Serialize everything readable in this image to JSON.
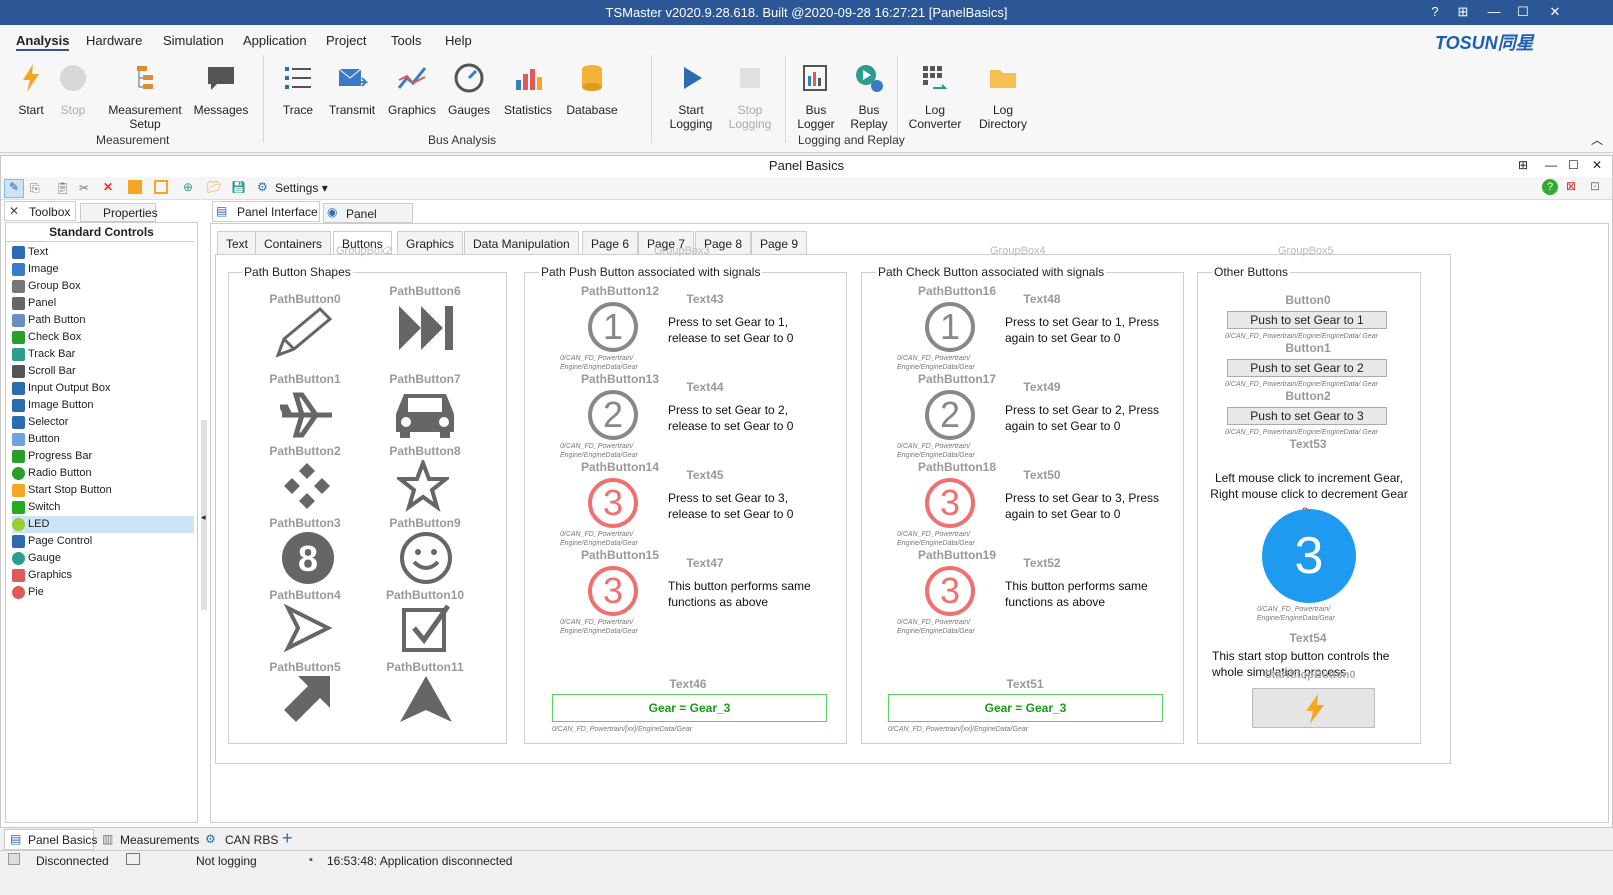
{
  "title": "TSMaster v2020.9.28.618. Built @2020-09-28 16:27:21 [PanelBasics]",
  "brand": "TOSUN同星",
  "window_buttons": [
    "?",
    "⊞",
    "—",
    "☐",
    "✕"
  ],
  "menu": [
    "Analysis",
    "Hardware",
    "Simulation",
    "Application",
    "Project",
    "Tools",
    "Help"
  ],
  "ribbon": {
    "start": "Start",
    "stop": "Stop",
    "measurement_setup_1": "Measurement",
    "measurement_setup_2": "Setup",
    "messages": "Messages",
    "trace": "Trace",
    "transmit": "Transmit",
    "graphics": "Graphics",
    "gauges": "Gauges",
    "statistics": "Statistics",
    "database": "Database",
    "start_logging_1": "Start",
    "start_logging_2": "Logging",
    "stop_logging_1": "Stop",
    "stop_logging_2": "Logging",
    "bus_logger_1": "Bus",
    "bus_logger_2": "Logger",
    "bus_replay_1": "Bus",
    "bus_replay_2": "Replay",
    "log_converter_1": "Log",
    "log_converter_2": "Converter",
    "log_directory_1": "Log",
    "log_directory_2": "Directory",
    "group_measurement": "Measurement",
    "group_bus_analysis": "Bus Analysis",
    "group_logging": "Logging and Replay"
  },
  "panel": {
    "title": "Panel Basics",
    "settings": "Settings",
    "toolbox_tab": "Toolbox",
    "properties_tab": "Properties",
    "interface_tab": "Panel Interface",
    "source_tab": "Panel Source",
    "standard_controls": "Standard Controls",
    "controls": [
      "Text",
      "Image",
      "Group Box",
      "Panel",
      "Path Button",
      "Check Box",
      "Track Bar",
      "Scroll Bar",
      "Input Output Box",
      "Image Button",
      "Selector",
      "Button",
      "Progress Bar",
      "Radio Button",
      "Start Stop Button",
      "Switch",
      "LED",
      "Page Control",
      "Gauge",
      "Graphics",
      "Pie"
    ],
    "page_tabs": [
      "Text",
      "Containers",
      "Buttons",
      "Graphics",
      "Data Manipulation",
      "Page 6",
      "Page 7",
      "Page 8",
      "Page 9"
    ]
  },
  "groups": {
    "g1": "Path Button Shapes",
    "g2": "Path Push Button associated with signals",
    "g3": "Path Check Button associated with signals",
    "g4": "Other Buttons",
    "ghost1": "GroupBox2",
    "ghost2": "GroupBox3",
    "ghost3": "GroupBox4",
    "ghost4": "GroupBox5"
  },
  "path_buttons": [
    "PathButton0",
    "PathButton6",
    "PathButton1",
    "PathButton7",
    "PathButton2",
    "PathButton8",
    "PathButton3",
    "PathButton9",
    "PathButton4",
    "PathButton10",
    "PathButton5",
    "PathButton11"
  ],
  "push": {
    "labels": [
      "PathButton12",
      "PathButton13",
      "PathButton14",
      "PathButton15"
    ],
    "texts": [
      "Text43",
      "Text44",
      "Text45",
      "Text47"
    ],
    "descs": [
      "Press to set Gear to 1,\nrelease to set Gear to 0",
      "Press to set Gear to 2,\nrelease to set Gear to 0",
      "Press to set Gear to 3,\nrelease to set Gear to 0",
      "This button performs same\nfunctions as above"
    ],
    "signal": "0/CAN_FD_Powertrain/\nEngine/EngineData/Gear",
    "gear_label": "Text46",
    "gear_value": "Gear = Gear_3",
    "gear_signal": "0/CAN_FD_Powertrain/[xx]/EngineData/Gear"
  },
  "check": {
    "labels": [
      "PathButton16",
      "PathButton17",
      "PathButton18",
      "PathButton19"
    ],
    "texts": [
      "Text48",
      "Text49",
      "Text50",
      "Text52"
    ],
    "descs": [
      "Press to set Gear to 1, Press\nagain to set Gear to 0",
      "Press to set Gear to 2, Press\nagain to set Gear to 0",
      "Press to set Gear to 3, Press\nagain to set Gear to 0",
      "This button performs same\nfunctions as above"
    ],
    "gear_label": "Text51",
    "gear_value": "Gear = Gear_3"
  },
  "other": {
    "button_labels": [
      "Button0",
      "Button1",
      "Button2"
    ],
    "buttons": [
      "Push to set Gear to 1",
      "Push to set Gear to 2",
      "Push to set Gear to 3"
    ],
    "signal": "0/CAN_FD_Powertrain/Engine/EngineData/\nGear",
    "text53": "Text53",
    "mouse_desc": "Left mouse click to increment Gear,\nRight mouse click to decrement Gear",
    "counter": "0",
    "big_value": "3",
    "big_signal": "0/CAN_FD_Powertrain/\nEngine/EngineData/Gear",
    "text54": "Text54",
    "ss_desc": "This start stop button controls the\nwhole simulation process",
    "ss_label": "StartStopButton0"
  },
  "gear_digits": [
    "1",
    "2",
    "3",
    "3"
  ],
  "gear_colors": [
    "#888888",
    "#888888",
    "#f07070",
    "#f07070"
  ],
  "bottom_tabs": [
    "Panel Basics",
    "Measurements",
    "CAN RBS"
  ],
  "status": {
    "conn": "Disconnected",
    "log": "Not logging",
    "msg": "16:53:48: Application disconnected"
  },
  "colors": {
    "title_bg": "#2b5797",
    "accent": "#1e9bf0",
    "brand": "#1a5fb4"
  }
}
